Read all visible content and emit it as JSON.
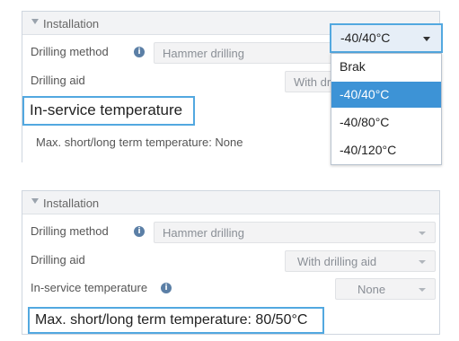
{
  "top": {
    "header": "Installation",
    "drilling_method_label": "Drilling method",
    "drilling_method_value": "Hammer drilling",
    "drilling_aid_label": "Drilling aid",
    "drilling_aid_value": "With drilling aid",
    "inservice_label": "In-service temperature",
    "max_temp_text": "Max. short/long term temperature: None",
    "dropdown": {
      "selected": "-40/40°C",
      "options": [
        "Brak",
        "-40/40°C",
        "-40/80°C",
        "-40/120°C"
      ],
      "highlighted_index": 1
    }
  },
  "bottom": {
    "header": "Installation",
    "drilling_method_label": "Drilling method",
    "drilling_method_value": "Hammer drilling",
    "drilling_aid_label": "Drilling aid",
    "drilling_aid_value": "With drilling aid",
    "inservice_label": "In-service temperature",
    "inservice_value": "None",
    "max_temp_text": "Max. short/long term temperature: 80/50°C"
  },
  "colors": {
    "highlight_border": "#52a8e0",
    "selected_option": "#3d93d6",
    "info_icon": "#5b7fa6"
  }
}
